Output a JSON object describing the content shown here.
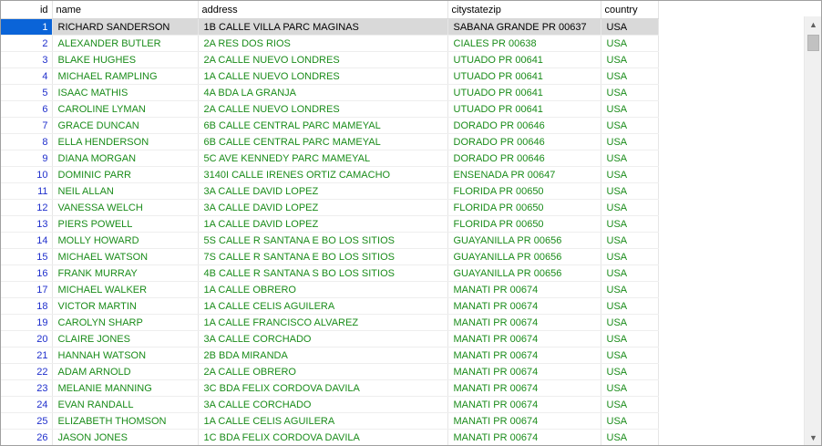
{
  "columns": [
    "id",
    "name",
    "address",
    "citystatezip",
    "country"
  ],
  "rows": [
    {
      "id": "1",
      "name": "RICHARD SANDERSON",
      "address": "1B CALLE VILLA PARC MAGINAS",
      "citystatezip": "SABANA GRANDE PR 00637",
      "country": "USA"
    },
    {
      "id": "2",
      "name": "ALEXANDER BUTLER",
      "address": "2A RES DOS RIOS",
      "citystatezip": "CIALES PR 00638",
      "country": "USA"
    },
    {
      "id": "3",
      "name": "BLAKE HUGHES",
      "address": "2A CALLE NUEVO LONDRES",
      "citystatezip": "UTUADO PR 00641",
      "country": "USA"
    },
    {
      "id": "4",
      "name": "MICHAEL RAMPLING",
      "address": "1A CALLE NUEVO LONDRES",
      "citystatezip": "UTUADO PR 00641",
      "country": "USA"
    },
    {
      "id": "5",
      "name": "ISAAC MATHIS",
      "address": "4A BDA LA GRANJA",
      "citystatezip": "UTUADO PR 00641",
      "country": "USA"
    },
    {
      "id": "6",
      "name": "CAROLINE LYMAN",
      "address": "2A CALLE NUEVO LONDRES",
      "citystatezip": "UTUADO PR 00641",
      "country": "USA"
    },
    {
      "id": "7",
      "name": "GRACE DUNCAN",
      "address": "6B CALLE CENTRAL PARC MAMEYAL",
      "citystatezip": "DORADO PR 00646",
      "country": "USA"
    },
    {
      "id": "8",
      "name": "ELLA HENDERSON",
      "address": "6B CALLE CENTRAL PARC MAMEYAL",
      "citystatezip": "DORADO PR 00646",
      "country": "USA"
    },
    {
      "id": "9",
      "name": "DIANA MORGAN",
      "address": "5C AVE KENNEDY PARC MAMEYAL",
      "citystatezip": "DORADO PR 00646",
      "country": "USA"
    },
    {
      "id": "10",
      "name": "DOMINIC PARR",
      "address": "3140I CALLE IRENES ORTIZ CAMACHO",
      "citystatezip": "ENSENADA PR 00647",
      "country": "USA"
    },
    {
      "id": "11",
      "name": "NEIL ALLAN",
      "address": "3A CALLE DAVID LOPEZ",
      "citystatezip": "FLORIDA PR 00650",
      "country": "USA"
    },
    {
      "id": "12",
      "name": "VANESSA WELCH",
      "address": "3A CALLE DAVID LOPEZ",
      "citystatezip": "FLORIDA PR 00650",
      "country": "USA"
    },
    {
      "id": "13",
      "name": "PIERS POWELL",
      "address": "1A CALLE DAVID LOPEZ",
      "citystatezip": "FLORIDA PR 00650",
      "country": "USA"
    },
    {
      "id": "14",
      "name": "MOLLY HOWARD",
      "address": "5S CALLE R SANTANA E BO LOS SITIOS",
      "citystatezip": "GUAYANILLA PR 00656",
      "country": "USA"
    },
    {
      "id": "15",
      "name": "MICHAEL WATSON",
      "address": "7S CALLE R SANTANA E BO LOS SITIOS",
      "citystatezip": "GUAYANILLA PR 00656",
      "country": "USA"
    },
    {
      "id": "16",
      "name": "FRANK MURRAY",
      "address": "4B CALLE R SANTANA S BO LOS SITIOS",
      "citystatezip": "GUAYANILLA PR 00656",
      "country": "USA"
    },
    {
      "id": "17",
      "name": "MICHAEL WALKER",
      "address": "1A CALLE OBRERO",
      "citystatezip": "MANATI PR 00674",
      "country": "USA"
    },
    {
      "id": "18",
      "name": "VICTOR MARTIN",
      "address": "1A CALLE CELIS AGUILERA",
      "citystatezip": "MANATI PR 00674",
      "country": "USA"
    },
    {
      "id": "19",
      "name": "CAROLYN SHARP",
      "address": "1A CALLE FRANCISCO ALVAREZ",
      "citystatezip": "MANATI PR 00674",
      "country": "USA"
    },
    {
      "id": "20",
      "name": "CLAIRE JONES",
      "address": "3A CALLE CORCHADO",
      "citystatezip": "MANATI PR 00674",
      "country": "USA"
    },
    {
      "id": "21",
      "name": "HANNAH WATSON",
      "address": "2B BDA MIRANDA",
      "citystatezip": "MANATI PR 00674",
      "country": "USA"
    },
    {
      "id": "22",
      "name": "ADAM ARNOLD",
      "address": "2A CALLE OBRERO",
      "citystatezip": "MANATI PR 00674",
      "country": "USA"
    },
    {
      "id": "23",
      "name": "MELANIE MANNING",
      "address": "3C BDA FELIX CORDOVA DAVILA",
      "citystatezip": "MANATI PR 00674",
      "country": "USA"
    },
    {
      "id": "24",
      "name": "EVAN RANDALL",
      "address": "3A CALLE CORCHADO",
      "citystatezip": "MANATI PR 00674",
      "country": "USA"
    },
    {
      "id": "25",
      "name": "ELIZABETH THOMSON",
      "address": "1A CALLE CELIS AGUILERA",
      "citystatezip": "MANATI PR 00674",
      "country": "USA"
    },
    {
      "id": "26",
      "name": "JASON JONES",
      "address": "1C BDA FELIX CORDOVA DAVILA",
      "citystatezip": "MANATI PR 00674",
      "country": "USA"
    }
  ],
  "selected_row": 0,
  "colors": {
    "id_text": "#1f2fcc",
    "cell_text": "#1a8c1a",
    "selected_id_bg": "#0a64d8",
    "selected_row_bg": "#d9d9d9"
  },
  "icons": {
    "scroll_up": "triangle-up-icon",
    "scroll_down": "triangle-down-icon"
  }
}
